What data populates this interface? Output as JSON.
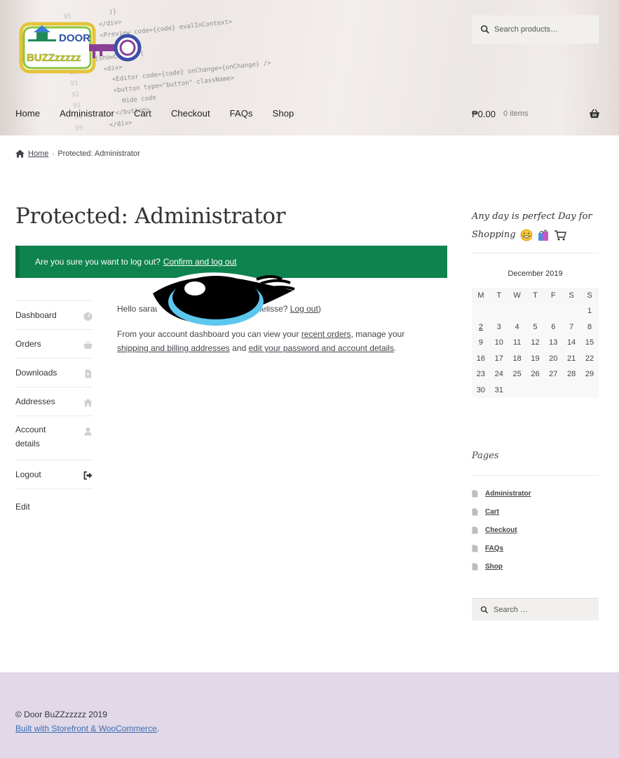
{
  "header": {
    "logo": {
      "line1": "DOOR",
      "line2": "BUZZzzzzz"
    },
    "search_placeholder": "Search products…",
    "nav": [
      "Home",
      "Administrator",
      "Cart",
      "Checkout",
      "FAQs",
      "Shop"
    ],
    "cart": {
      "amount": "₱0.00",
      "items": "0 items"
    }
  },
  "breadcrumb": {
    "home": "Home",
    "separator": "›",
    "current": "Protected: Administrator"
  },
  "main": {
    "title": "Protected: Administrator",
    "notice": {
      "text": "Are you sure you want to log out?",
      "link": "Confirm and log out"
    },
    "account_nav": [
      {
        "label": "Dashboard",
        "icon": "dashboard-icon"
      },
      {
        "label": "Orders",
        "icon": "basket-icon"
      },
      {
        "label": "Downloads",
        "icon": "file-icon"
      },
      {
        "label": "Addresses",
        "icon": "house-icon"
      },
      {
        "label": "Account details",
        "icon": "user-icon"
      },
      {
        "label": "Logout",
        "icon": "sign-out-icon"
      },
      {
        "label": "Edit"
      }
    ],
    "hello": {
      "prefix": "Hello",
      "name": "sarat",
      "middle": "melisse?",
      "logout": "Log out",
      "suffix": ")"
    },
    "desc": {
      "t1": "From your account dashboard you can view your",
      "l1": "recent orders",
      "t2": ", manage your",
      "l2": "shipping and billing addresses",
      "t3": "and",
      "l3": "edit your password and account details",
      "t4": "."
    }
  },
  "sidebar": {
    "tagline": "Any day is perfect Day for Shopping",
    "tagline_emojis": [
      "grinning-face-icon",
      "shopping-bags-icon",
      "shopping-cart-icon"
    ],
    "calendar": {
      "caption": "December 2019",
      "days": [
        "M",
        "T",
        "W",
        "T",
        "F",
        "S",
        "S"
      ],
      "weeks": [
        [
          "",
          "",
          "",
          "",
          "",
          "",
          "1"
        ],
        [
          "2",
          "3",
          "4",
          "5",
          "6",
          "7",
          "8"
        ],
        [
          "9",
          "10",
          "11",
          "12",
          "13",
          "14",
          "15"
        ],
        [
          "16",
          "17",
          "18",
          "19",
          "20",
          "21",
          "22"
        ],
        [
          "23",
          "24",
          "25",
          "26",
          "27",
          "28",
          "29"
        ],
        [
          "30",
          "31",
          "",
          "",
          "",
          "",
          ""
        ]
      ]
    },
    "pages_title": "Pages",
    "pages": [
      "Administrator",
      "Cart",
      "Checkout",
      "FAQs",
      "Shop"
    ],
    "search_placeholder": "Search …"
  },
  "footer": {
    "copyright": "© Door BuZZzzzzz 2019",
    "built_link": "Built with Storefront & WooCommerce",
    "built_suffix": "."
  },
  "colors": {
    "notice_bg": "#0f834d",
    "footer_bg": "#e1d8e8",
    "link_blue": "#3b6db3"
  }
}
